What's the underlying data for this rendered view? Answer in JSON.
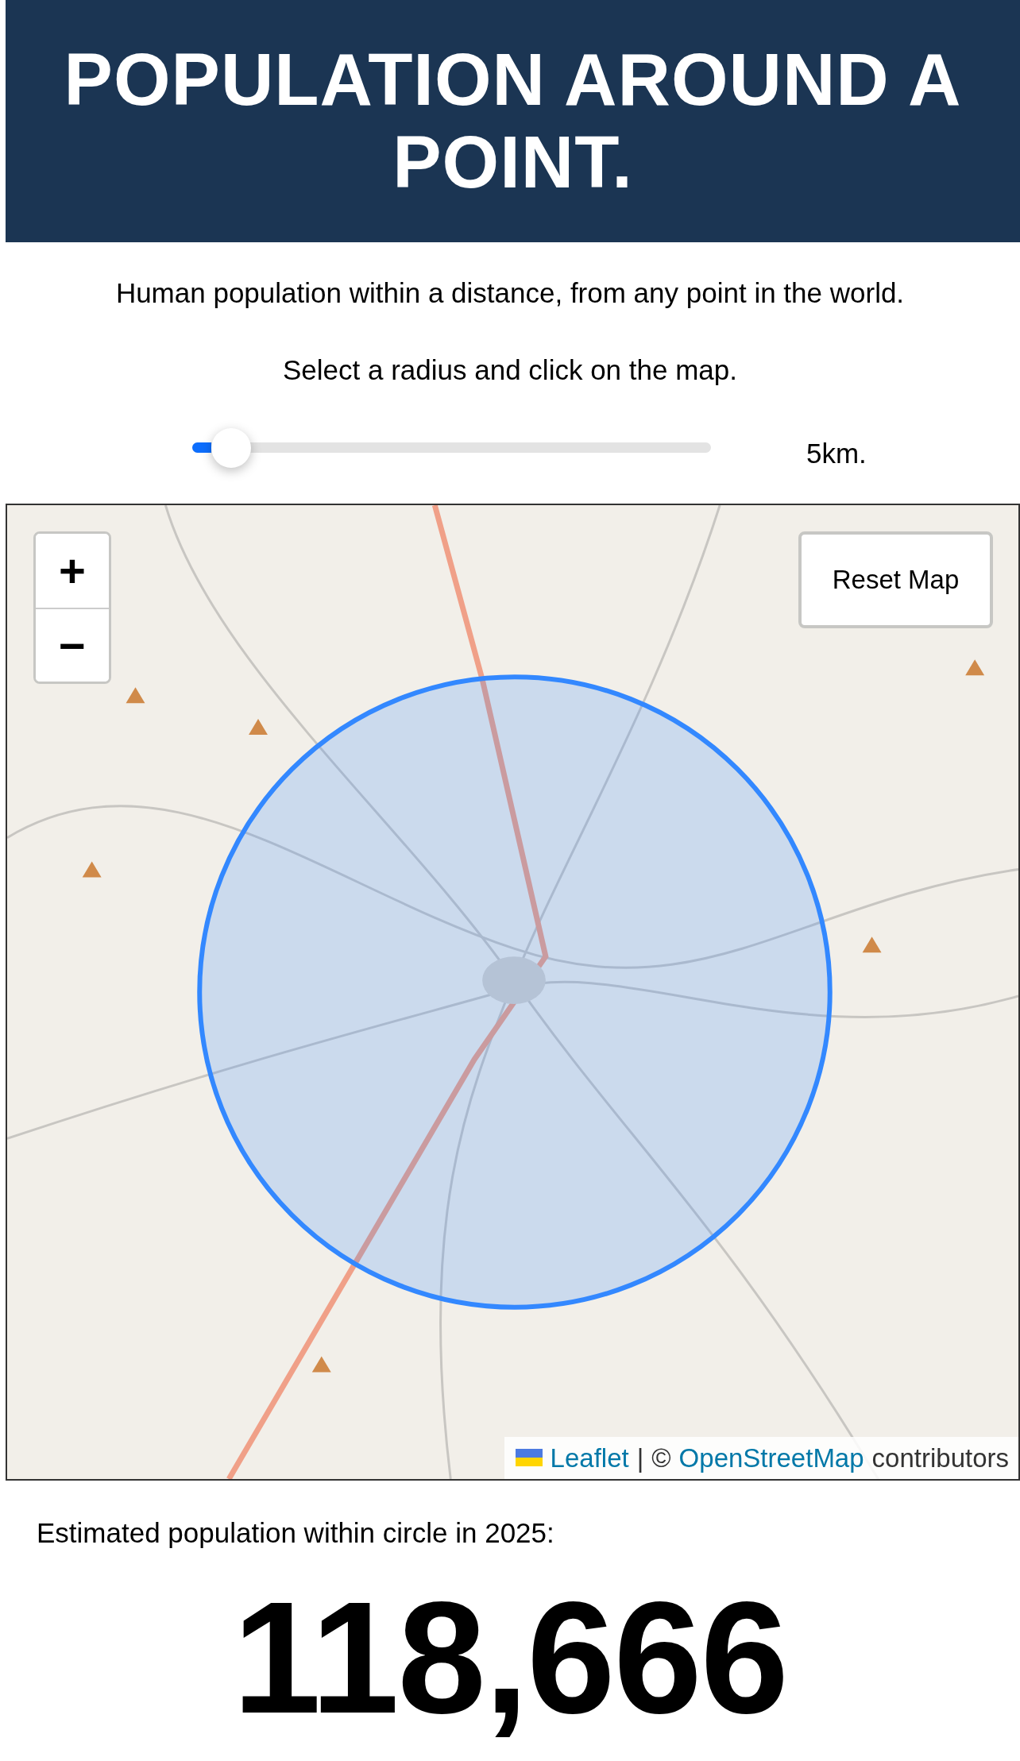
{
  "header": {
    "title": "POPULATION AROUND A POINT."
  },
  "intro": [
    "Human population within a distance, from any point in the world.",
    "Select a radius and click on the map."
  ],
  "radius_slider": {
    "level": 0.02,
    "reading": "5km."
  },
  "map": {
    "kind": "picture",
    "zoom_in": "+",
    "zoom_out": "−",
    "reset_button": "Reset Map",
    "attribution": {
      "link_1": "Leaflet",
      "separator": "|",
      "copyright": "©",
      "link_2": "OpenStreetMap",
      "suffix": "contributors"
    }
  },
  "result": {
    "label": "Estimated population within circle in 2025:",
    "value": "118,666"
  }
}
